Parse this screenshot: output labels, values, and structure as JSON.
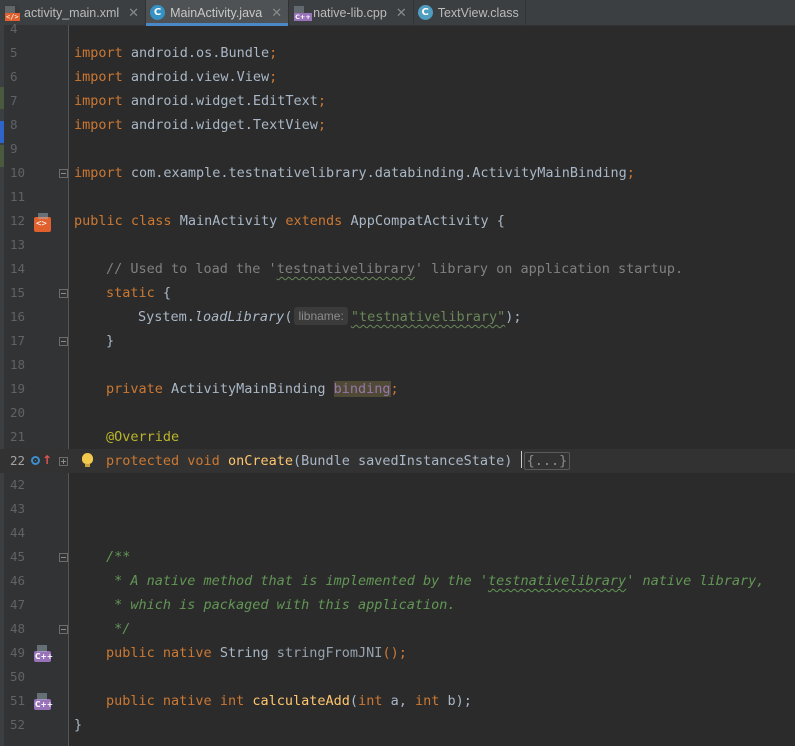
{
  "tabs": [
    {
      "label": "activity_main.xml",
      "icon": "xml-file-icon",
      "active": false
    },
    {
      "label": "MainActivity.java",
      "icon": "java-class-icon",
      "active": true
    },
    {
      "label": "native-lib.cpp",
      "icon": "cpp-file-icon",
      "active": false
    },
    {
      "label": "TextView.class",
      "icon": "class-file-icon",
      "active": false
    }
  ],
  "close_glyph": "✕",
  "editor": {
    "current_line": "22",
    "lines": [
      {
        "n": "4"
      },
      {
        "n": "5",
        "t": [
          "import",
          "android.os.Bundle",
          ";"
        ]
      },
      {
        "n": "6",
        "t": [
          "import",
          "android.view.View",
          ";"
        ]
      },
      {
        "n": "7",
        "t": [
          "import",
          "android.widget.EditText",
          ";"
        ]
      },
      {
        "n": "8",
        "t": [
          "import",
          "android.widget.TextView",
          ";"
        ]
      },
      {
        "n": "9"
      },
      {
        "n": "10",
        "t": [
          "import",
          "com.example.testnativelibrary.databinding.ActivityMainBinding",
          ";"
        ]
      },
      {
        "n": "11"
      },
      {
        "n": "12",
        "t": [
          "public",
          "class",
          "MainActivity",
          "extends",
          "AppCompatActivity {"
        ]
      },
      {
        "n": "13"
      },
      {
        "n": "14",
        "t": [
          "// Used to load the '",
          "testnativelibrary",
          "' library on application startup."
        ]
      },
      {
        "n": "15",
        "t": [
          "static",
          " {"
        ]
      },
      {
        "n": "16",
        "t": [
          "System.",
          "loadLibrary",
          "(",
          "libname:",
          "\"testnativelibrary\"",
          ");"
        ]
      },
      {
        "n": "17",
        "t": [
          "}"
        ]
      },
      {
        "n": "18"
      },
      {
        "n": "19",
        "t": [
          "private",
          "ActivityMainBinding",
          "binding",
          ";"
        ]
      },
      {
        "n": "20"
      },
      {
        "n": "21",
        "t": [
          "@Override"
        ]
      },
      {
        "n": "22",
        "t": [
          "protected",
          "void",
          "onCreate",
          "(Bundle savedInstanceState)",
          "{...}"
        ]
      },
      {
        "n": "42"
      },
      {
        "n": "43"
      },
      {
        "n": "44"
      },
      {
        "n": "45",
        "t": [
          "/**"
        ]
      },
      {
        "n": "46",
        "t": [
          " * A native method that is implemented by the '",
          "testnativelibrary",
          "' native library,"
        ]
      },
      {
        "n": "47",
        "t": [
          " * which is packaged with this application."
        ]
      },
      {
        "n": "48",
        "t": [
          " */"
        ]
      },
      {
        "n": "49",
        "t": [
          "public",
          "native",
          "String",
          "stringFromJNI",
          "();"
        ]
      },
      {
        "n": "50"
      },
      {
        "n": "51",
        "t": [
          "public",
          "native",
          "int",
          "calculateAdd",
          "(",
          "int",
          "a,",
          "int",
          "b);"
        ]
      },
      {
        "n": "52",
        "t": [
          "}"
        ]
      }
    ]
  },
  "gutter_icons": [
    {
      "line": "12",
      "icon": "layout-xml-icon"
    },
    {
      "line": "22",
      "icon": "override-method-icon"
    },
    {
      "line": "22",
      "icon": "lightbulb-icon"
    },
    {
      "line": "49",
      "icon": "cpp-native-icon"
    },
    {
      "line": "51",
      "icon": "cpp-native-icon"
    }
  ],
  "colors": {
    "background": "#2b2b2b",
    "gutter": "#313335",
    "keyword": "#cc7832",
    "string": "#6a8759",
    "comment": "#808080",
    "doc_comment": "#629755",
    "method": "#ffc66d",
    "annotation": "#bbb529",
    "text": "#a9b7c6",
    "active_tab_underline": "#4a88c7"
  }
}
